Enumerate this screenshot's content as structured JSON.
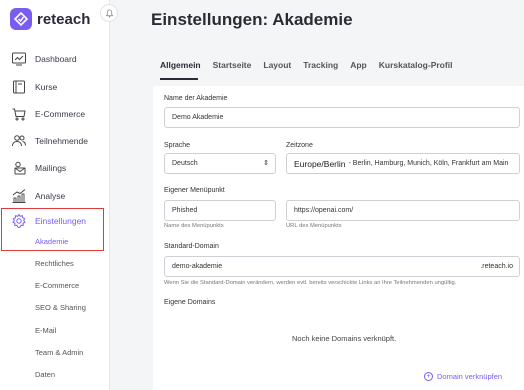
{
  "brand": {
    "name": "reteach",
    "color": "#7b5cf0"
  },
  "sidebar": {
    "items": [
      {
        "label": "Dashboard",
        "icon": "dashboard-icon"
      },
      {
        "label": "Kurse",
        "icon": "course-icon"
      },
      {
        "label": "E-Commerce",
        "icon": "cart-icon"
      },
      {
        "label": "Teilnehmende",
        "icon": "users-icon"
      },
      {
        "label": "Mailings",
        "icon": "mail-icon"
      },
      {
        "label": "Analyse",
        "icon": "chart-icon"
      },
      {
        "label": "Einstellungen",
        "icon": "gear-icon",
        "active": true
      }
    ],
    "sub_items": [
      {
        "label": "Akademie",
        "active": true
      },
      {
        "label": "Rechtliches"
      },
      {
        "label": "E-Commerce"
      },
      {
        "label": "SEO & Sharing"
      },
      {
        "label": "E-Mail"
      },
      {
        "label": "Team & Admin"
      },
      {
        "label": "Daten"
      }
    ]
  },
  "page": {
    "title": "Einstellungen: Akademie"
  },
  "tabs": [
    "Allgemein",
    "Startseite",
    "Layout",
    "Tracking",
    "App",
    "Kurskatalog-Profil"
  ],
  "form": {
    "academy_name_label": "Name der Akademie",
    "academy_name_value": "Demo Akademie",
    "language_label": "Sprache",
    "language_value": "Deutsch",
    "timezone_label": "Zeitzone",
    "timezone_main": "Europe/Berlin",
    "timezone_rest": "- Berlin, Hamburg, Munich, Köln, Frankfurt am Main",
    "menu_item_label": "Eigener Menüpunkt",
    "menu_name_value": "Phished",
    "menu_name_hint": "Name des Menüpunkts",
    "menu_url_value": "https://openai.com/",
    "menu_url_hint": "URL des Menüpunkts",
    "domain_label": "Standard-Domain",
    "domain_value": "demo-akademie",
    "domain_suffix": ".reteach.io",
    "domain_hint": "Wenn Sie die Standard-Domain verändern, werden evtl. bereits verschickte Links an Ihre Teilnehmenden ungültig.",
    "own_domains_label": "Eigene Domains",
    "no_domains_text": "Noch keine Domains verknüpft.",
    "link_domain_label": "Domain verknüpfen"
  },
  "colors": {
    "accent": "#7b5cf0",
    "highlight_box": "#e03b3b"
  }
}
